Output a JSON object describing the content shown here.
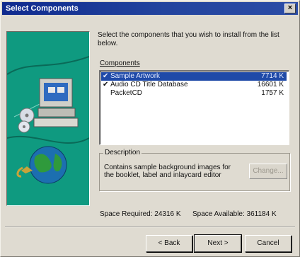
{
  "window": {
    "title": "Select Components"
  },
  "instruction": "Select the components that you wish to install from the list below.",
  "components": {
    "label": "Components",
    "items": [
      {
        "checked": true,
        "name": "Sample Artwork",
        "size": "7714 K",
        "selected": true
      },
      {
        "checked": true,
        "name": "Audio CD Title Database",
        "size": "16601 K",
        "selected": false
      },
      {
        "checked": false,
        "name": "PacketCD",
        "size": "1757 K",
        "selected": false
      }
    ]
  },
  "description": {
    "legend": "Description",
    "text": "Contains sample background images for the booklet, label and inlaycard editor",
    "change_label": "Change..."
  },
  "space": {
    "required_label": "Space Required:",
    "required_value": "24316 K",
    "available_label": "Space Available:",
    "available_value": "361184 K"
  },
  "buttons": {
    "back": "< Back",
    "next": "Next >",
    "cancel": "Cancel"
  },
  "icons": [
    "close-icon",
    "computer-icon",
    "cd-icon",
    "globe-icon",
    "checkmark-icon"
  ],
  "colors": {
    "title_bar": "#1f3a9a",
    "art_background": "#0f9a80",
    "selection": "#1f4aa8"
  }
}
